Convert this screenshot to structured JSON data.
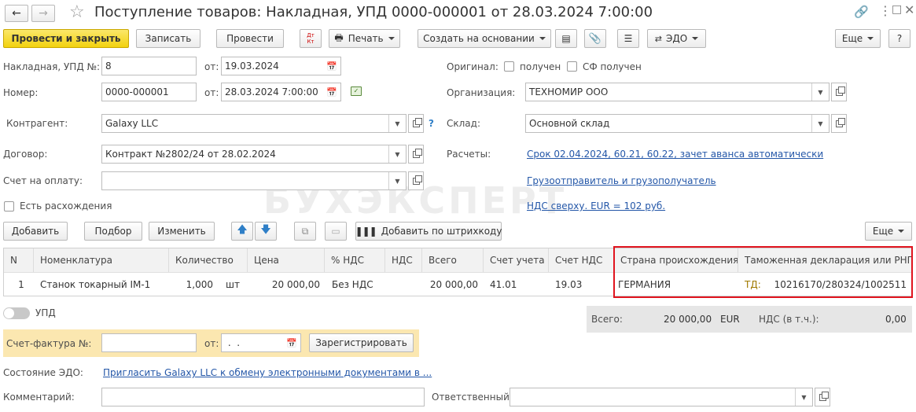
{
  "header": {
    "title": "Поступление товаров: Накладная, УПД 0000-000001 от 28.03.2024 7:00:00"
  },
  "toolbar": {
    "post_close": "Провести и закрыть",
    "save": "Записать",
    "post": "Провести",
    "dt_kt": "Дт",
    "kt": "Кт",
    "print": "Печать",
    "create_based": "Создать на основании",
    "edo": "ЭДО",
    "more": "Еще",
    "help": "?"
  },
  "form": {
    "invoice_label": "Накладная, УПД №:",
    "invoice_no": "8",
    "from_label": "от:",
    "invoice_date": "19.03.2024",
    "number_label": "Номер:",
    "number": "0000-000001",
    "number_date": "28.03.2024  7:00:00",
    "counterparty_label": "Контрагент:",
    "counterparty": "Galaxy LLC",
    "contract_label": "Договор:",
    "contract": "Контракт №2802/24 от 28.02.2024",
    "pay_account_label": "Счет на оплату:",
    "pay_account": "",
    "discrepancy_label": "Есть расхождения",
    "original_label": "Оригинал:",
    "received_label": "получен",
    "sf_received_label": "СФ получен",
    "org_label": "Организация:",
    "org": "ТЕХНОМИР ООО",
    "warehouse_label": "Склад:",
    "warehouse": "Основной склад",
    "settlements_label": "Расчеты:",
    "settlements_link": "Срок 02.04.2024, 60.21, 60.22, зачет аванса автоматически",
    "shipper_link": "Грузоотправитель и грузополучатель",
    "vat_link": "НДС сверху. EUR = 102 руб.",
    "question": "?"
  },
  "watermark": "БУХЭКСПЕРТ",
  "table_toolbar": {
    "add": "Добавить",
    "select": "Подбор",
    "edit": "Изменить",
    "barcode": "Добавить по штрихкоду",
    "more": "Еще"
  },
  "table": {
    "columns": [
      "N",
      "Номенклатура",
      "Количество",
      "Цена",
      "% НДС",
      "НДС",
      "Всего",
      "Счет учета",
      "Счет НДС",
      "Страна происхождения",
      "Таможенная декларация или РНПТ"
    ],
    "row": {
      "n": "1",
      "item": "Станок токарный IM-1",
      "qty": "1,000",
      "unit": "шт",
      "price": "20 000,00",
      "vat_rate": "Без НДС",
      "vat": "",
      "total": "20 000,00",
      "account": "41.01",
      "vat_account": "19.03",
      "country": "ГЕРМАНИЯ",
      "decl_prefix": "ТД:",
      "decl": "10216170/280324/1002511"
    }
  },
  "footer": {
    "upd_label": "УПД",
    "sf_label": "Счет-фактура №:",
    "sf_no": "",
    "sf_from": "от:",
    "sf_date": " .  .",
    "register": "Зарегистрировать",
    "edo_state_label": "Состояние ЭДО:",
    "edo_link": "Пригласить Galaxy LLC к обмену электронными документами в ...",
    "comment_label": "Комментарий:",
    "comment": "",
    "responsible_label": "Ответственный:",
    "responsible": "",
    "total_label": "Всего:",
    "total": "20 000,00",
    "currency": "EUR",
    "vat_incl_label": "НДС (в т.ч.):",
    "vat_incl": "0,00"
  },
  "colors": {
    "highlight_border": "#e0141e",
    "primary_button": "#f4d516",
    "link": "#2457a8",
    "decl_prefix": "#a07a00"
  }
}
